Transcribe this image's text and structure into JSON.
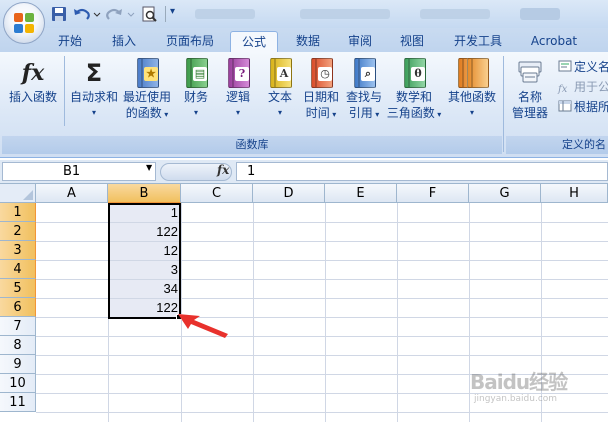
{
  "tabs": [
    {
      "label": "开始"
    },
    {
      "label": "插入"
    },
    {
      "label": "页面布局"
    },
    {
      "label": "公式",
      "active": true
    },
    {
      "label": "数据"
    },
    {
      "label": "审阅"
    },
    {
      "label": "视图"
    },
    {
      "label": "开发工具"
    },
    {
      "label": "Acrobat"
    }
  ],
  "ribbon": {
    "insert_function": "插入函数",
    "autosum": "自动求和",
    "recent_1": "最近使用",
    "recent_2": "的函数",
    "financial": "财务",
    "logical": "逻辑",
    "text": "文本",
    "datetime_1": "日期和",
    "datetime_2": "时间",
    "lookup_1": "查找与",
    "lookup_2": "引用",
    "math_1": "数学和",
    "math_2": "三角函数",
    "more": "其他函数",
    "name_mgr_1": "名称",
    "name_mgr_2": "管理器",
    "define_name": "定义名",
    "use_in_formula": "用于公",
    "create_from_sel": "根据所",
    "group_library": "函数库",
    "group_defined_names": "定义的名"
  },
  "formula_bar": {
    "name_box": "B1",
    "fx": "fx",
    "content": "1"
  },
  "columns": [
    "A",
    "B",
    "C",
    "D",
    "E",
    "F",
    "G",
    "H"
  ],
  "rows": [
    "1",
    "2",
    "3",
    "4",
    "5",
    "6",
    "7",
    "8",
    "9",
    "10",
    "11"
  ],
  "cells_b": [
    "1",
    "122",
    "12",
    "3",
    "34",
    "122"
  ],
  "watermark": {
    "main": "Baidu经验",
    "sub": "jingyan.baidu.com"
  },
  "colors": {
    "accent": "#15428b",
    "selected_header": "#f1c05e",
    "arrow": "#e8312c"
  }
}
